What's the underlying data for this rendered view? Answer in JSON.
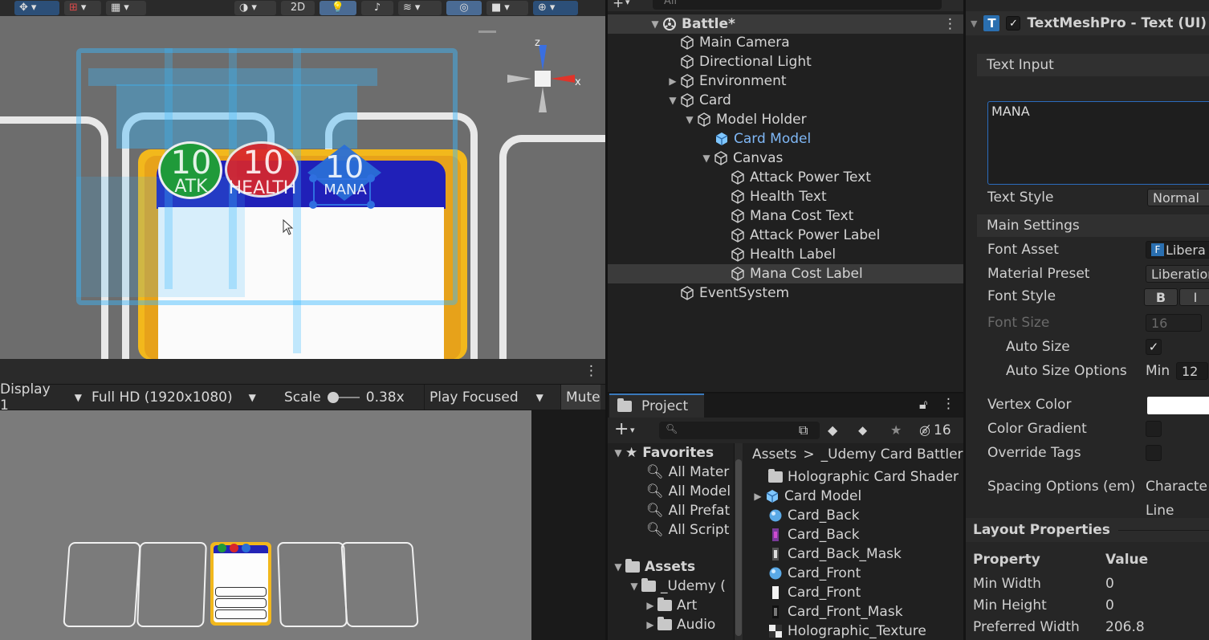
{
  "scene": {
    "toolbar": {
      "mode_2d": "2D"
    },
    "gizmo": {
      "axis_z": "z",
      "axis_x": "x"
    },
    "badges": [
      {
        "value": "10",
        "label": "ATK"
      },
      {
        "value": "10",
        "label": "HEALTH"
      },
      {
        "value": "10",
        "label": "MANA"
      }
    ]
  },
  "game": {
    "display": "Display 1",
    "resolution": "Full HD (1920x1080)",
    "scale_label": "Scale",
    "scale_value": "0.38x",
    "play_mode": "Play Focused",
    "mute": "Mute"
  },
  "hierarchy": {
    "scene_name": "Battle*",
    "search_placeholder": "All",
    "items": [
      {
        "label": "Main Camera"
      },
      {
        "label": "Directional Light"
      },
      {
        "label": "Environment"
      },
      {
        "label": "Card"
      },
      {
        "label": "Model Holder"
      },
      {
        "label": "Card Model"
      },
      {
        "label": "Canvas"
      },
      {
        "label": "Attack Power Text"
      },
      {
        "label": "Health Text"
      },
      {
        "label": "Mana Cost Text"
      },
      {
        "label": "Attack Power Label"
      },
      {
        "label": "Health Label"
      },
      {
        "label": "Mana Cost Label"
      },
      {
        "label": "EventSystem"
      }
    ]
  },
  "project": {
    "tab_label": "Project",
    "hidden_count": "16",
    "favorites_label": "Favorites",
    "favorites": [
      {
        "label": "All Mater"
      },
      {
        "label": "All Model"
      },
      {
        "label": "All Prefat"
      },
      {
        "label": "All Script"
      }
    ],
    "assets_label": "Assets",
    "tree": [
      {
        "label": "_Udemy ("
      },
      {
        "label": "Art"
      },
      {
        "label": "Audio"
      }
    ],
    "breadcrumb": {
      "root": "Assets",
      "sep": ">",
      "folder": "_Udemy Card Battler"
    },
    "files": [
      {
        "label": "Holographic Card Shader"
      },
      {
        "label": "Card Model"
      },
      {
        "label": "Card_Back"
      },
      {
        "label": "Card_Back"
      },
      {
        "label": "Card_Back_Mask"
      },
      {
        "label": "Card_Front"
      },
      {
        "label": "Card_Front"
      },
      {
        "label": "Card_Front_Mask"
      },
      {
        "label": "Holographic_Texture"
      }
    ]
  },
  "inspector": {
    "component_title": "TextMeshPro - Text (UI)",
    "component_icon": "T",
    "text_input_header": "Text Input",
    "text_value": "MANA",
    "text_style_label": "Text Style",
    "text_style_value": "Normal",
    "main_settings_header": "Main Settings",
    "font_asset_label": "Font Asset",
    "font_asset_value": "Libera",
    "material_preset_label": "Material Preset",
    "material_preset_value": "Liberation",
    "font_style_label": "Font Style",
    "font_style_b": "B",
    "font_style_i": "I",
    "font_size_label": "Font Size",
    "font_size_value": "16",
    "auto_size_label": "Auto Size",
    "auto_size_options_label": "Auto Size Options",
    "min_label": "Min",
    "min_value": "12",
    "vertex_color_label": "Vertex Color",
    "color_gradient_label": "Color Gradient",
    "override_tags_label": "Override Tags",
    "spacing_label": "Spacing Options (em)",
    "spacing_character": "Characte",
    "spacing_line": "Line",
    "layout_header": "Layout Properties",
    "layout_columns": {
      "property": "Property",
      "value": "Value"
    },
    "layout_rows": [
      {
        "property": "Min Width",
        "value": "0"
      },
      {
        "property": "Min Height",
        "value": "0"
      },
      {
        "property": "Preferred Width",
        "value": "206.8"
      }
    ]
  },
  "colors": {
    "accent_blue": "#3a79bb",
    "card_yellow": "#f2b81c",
    "badge_green": "#1f9a3a",
    "badge_red": "#d8262c",
    "badge_blue": "#2a6fd6",
    "highlight_cyan": "#39b8ff"
  }
}
